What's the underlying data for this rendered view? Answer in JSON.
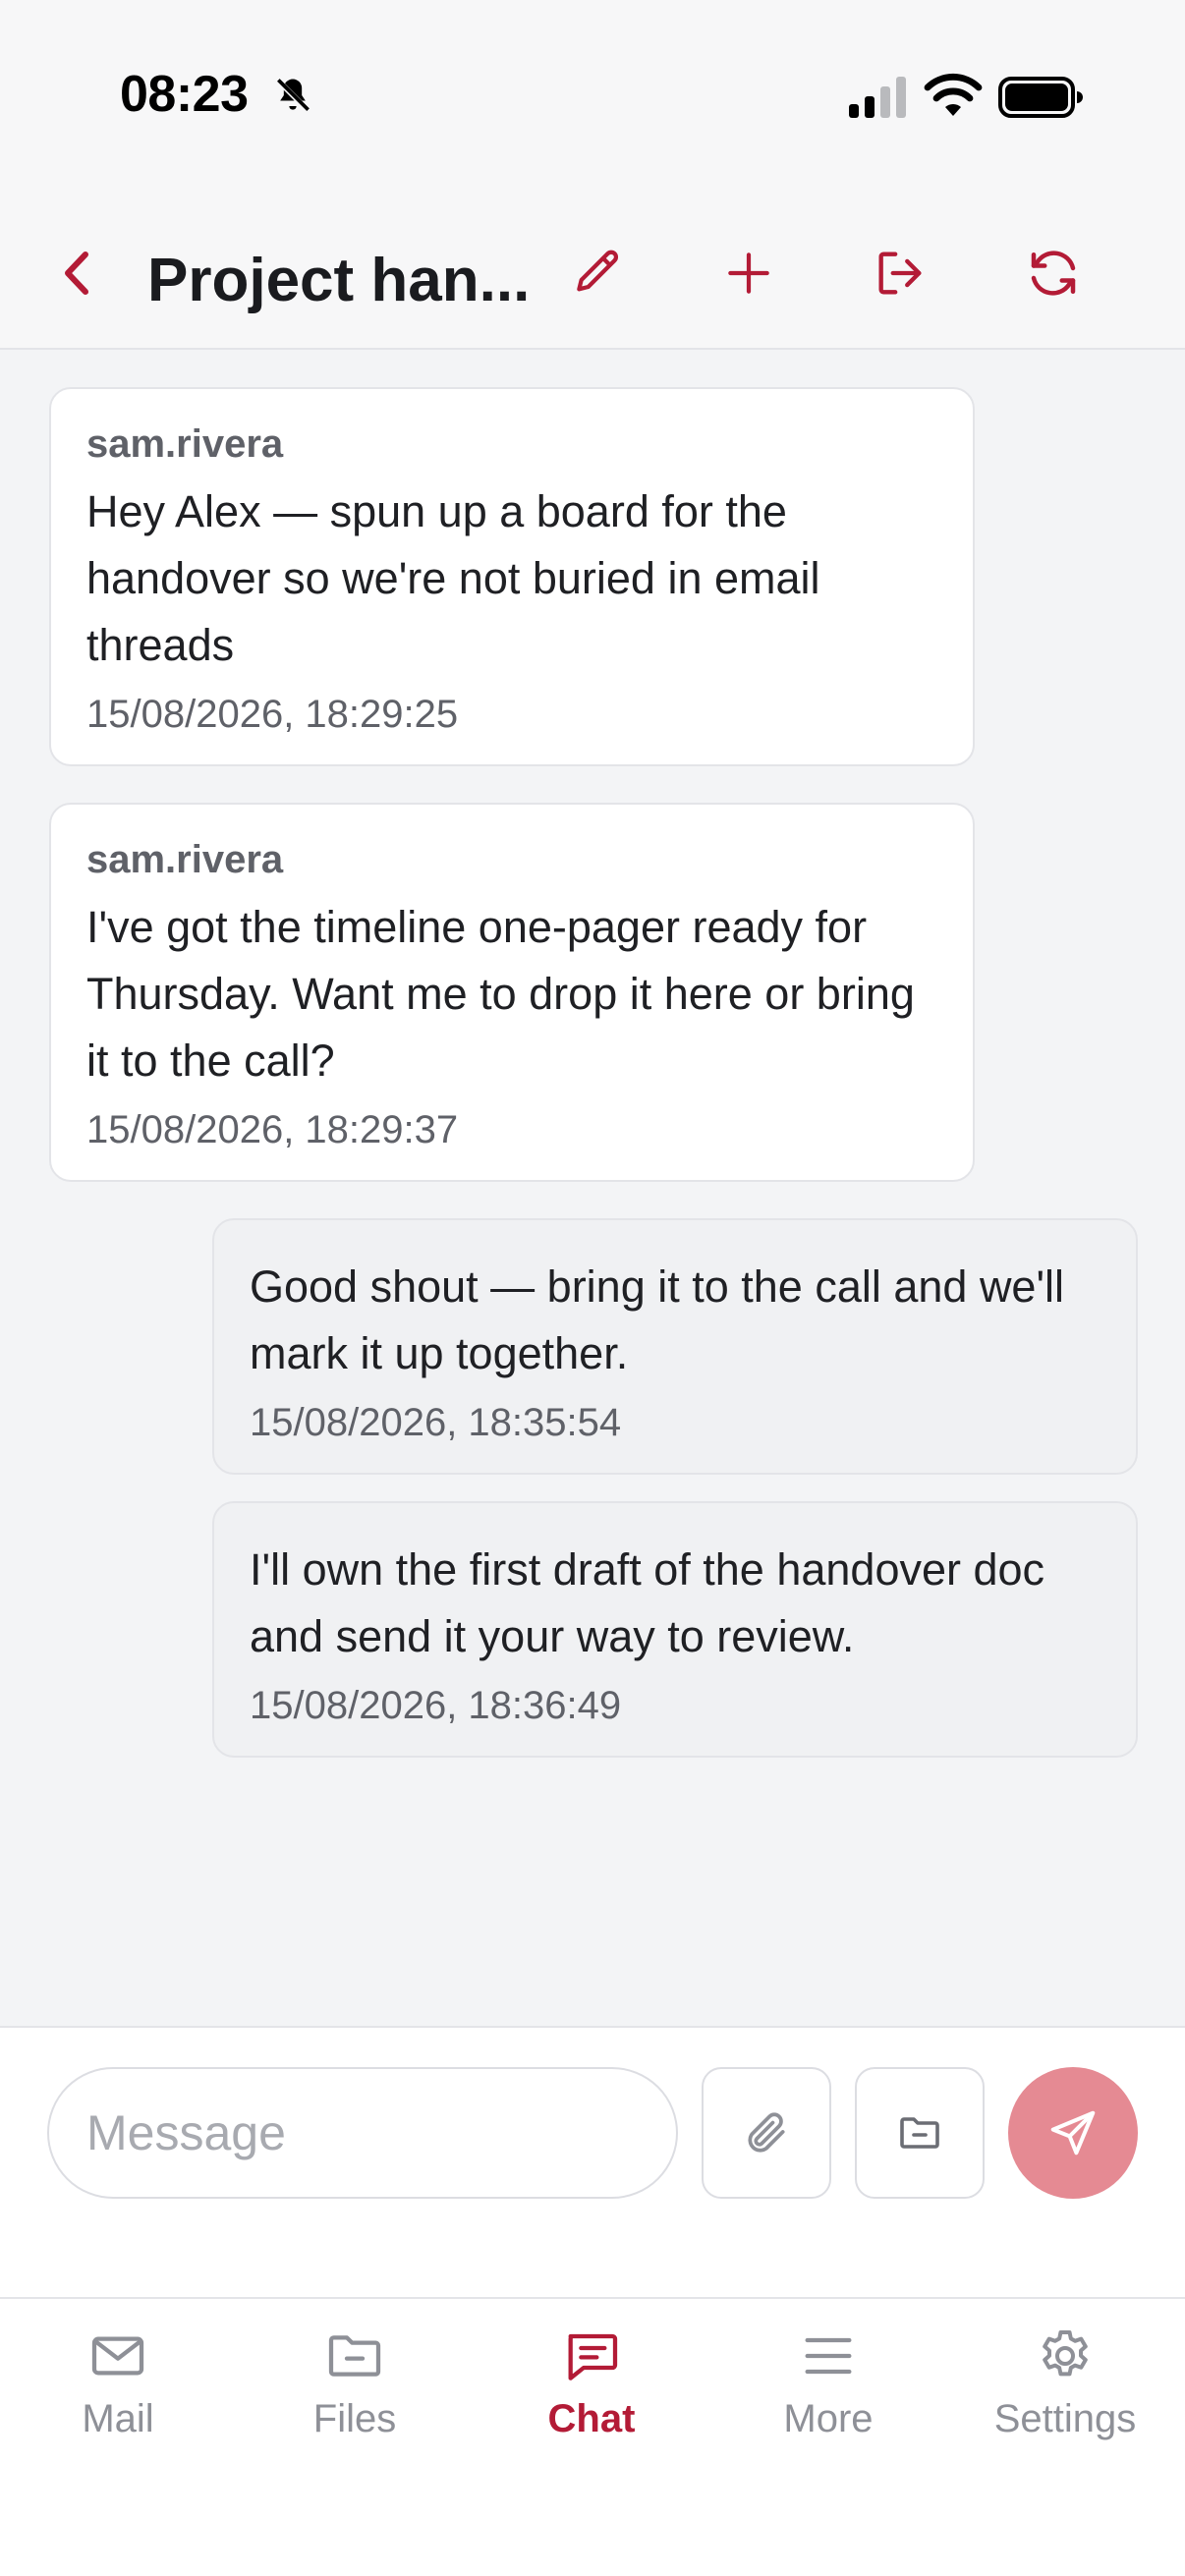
{
  "status_bar": {
    "time": "08:23"
  },
  "header": {
    "title": "Project han...",
    "back_icon": "chevron-left-icon",
    "actions": [
      "edit-icon",
      "plus-icon",
      "leave-icon",
      "refresh-icon"
    ]
  },
  "messages": [
    {
      "direction": "incoming",
      "sender": "sam.rivera",
      "text": "Hey Alex — spun up a board for the handover so we're not buried in email threads",
      "time": "15/08/2026, 18:29:25"
    },
    {
      "direction": "incoming",
      "sender": "sam.rivera",
      "text": "I've got the timeline one-pager ready for Thursday. Want me to drop it here or bring it to the call?",
      "time": "15/08/2026, 18:29:37"
    },
    {
      "direction": "outgoing",
      "text": "Good shout — bring it to the call and we'll mark it up together.",
      "time": "15/08/2026, 18:35:54"
    },
    {
      "direction": "outgoing",
      "text": "I'll own the first draft of the handover doc and send it your way to review.",
      "time": "15/08/2026, 18:36:49"
    }
  ],
  "composer": {
    "placeholder": "Message",
    "value": "",
    "attach_icon": "paperclip-icon",
    "folder_icon": "folder-icon",
    "send_icon": "send-icon"
  },
  "tabs": [
    {
      "label": "Mail",
      "icon": "mail-icon",
      "active": false
    },
    {
      "label": "Files",
      "icon": "folder-icon",
      "active": false
    },
    {
      "label": "Chat",
      "icon": "chat-icon",
      "active": true
    },
    {
      "label": "More",
      "icon": "menu-icon",
      "active": false
    },
    {
      "label": "Settings",
      "icon": "gear-icon",
      "active": false
    }
  ],
  "colors": {
    "accent": "#b31b36",
    "send_button": "#e58a93",
    "inactive_tab": "#8e9097"
  }
}
